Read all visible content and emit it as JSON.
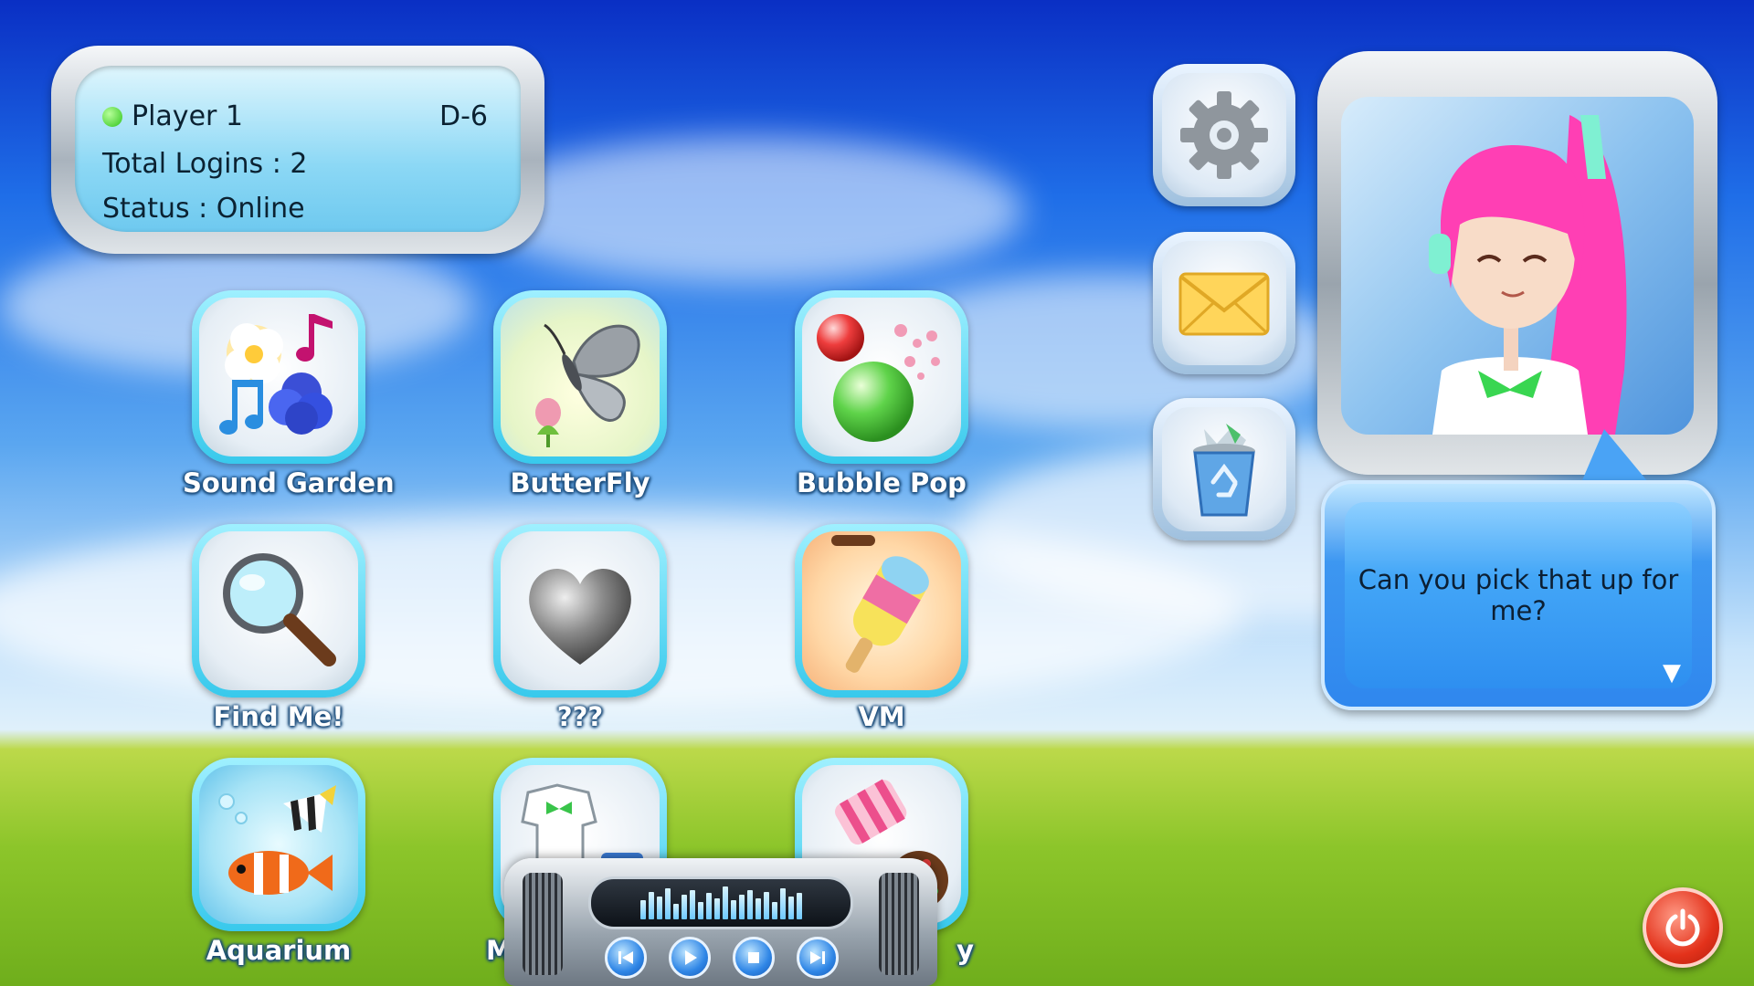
{
  "status_panel": {
    "player_name": "Player 1",
    "player_code": "D-6",
    "total_logins_label": "Total Logins : 2",
    "status_label": "Status : Online",
    "online_color": "#2fc41a"
  },
  "apps": [
    {
      "label": "Sound Garden",
      "icon": "flower-music-icon"
    },
    {
      "label": "ButterFly",
      "icon": "butterfly-icon"
    },
    {
      "label": "Bubble Pop",
      "icon": "bubbles-icon"
    },
    {
      "label": "Find Me!",
      "icon": "magnifier-icon"
    },
    {
      "label": "???",
      "icon": "heart-icon"
    },
    {
      "label": "VM",
      "icon": "popsicle-icon"
    },
    {
      "label": "Aquarium",
      "icon": "fish-icon"
    },
    {
      "label": "M",
      "icon": "clothes-icon"
    },
    {
      "label": "y",
      "icon": "candy-icon"
    }
  ],
  "side_buttons": [
    {
      "icon": "gear-icon"
    },
    {
      "icon": "mail-icon"
    },
    {
      "icon": "recycle-bin-icon"
    }
  ],
  "dialogue": {
    "text": "Can you pick that up for me?",
    "next_indicator": "▼"
  },
  "music_player": {
    "eq_levels": [
      0.55,
      0.8,
      0.65,
      0.9,
      0.45,
      0.7,
      0.85,
      0.5,
      0.75,
      0.6,
      0.95,
      0.55,
      0.7,
      0.85,
      0.6,
      0.8,
      0.5,
      0.9,
      0.65,
      0.75
    ],
    "controls": [
      "previous-icon",
      "play-icon",
      "stop-icon",
      "next-icon"
    ]
  },
  "colors": {
    "tile_border": "#38c9ec",
    "speech_bubble": "#2f87ee",
    "power": "#e3321b"
  }
}
